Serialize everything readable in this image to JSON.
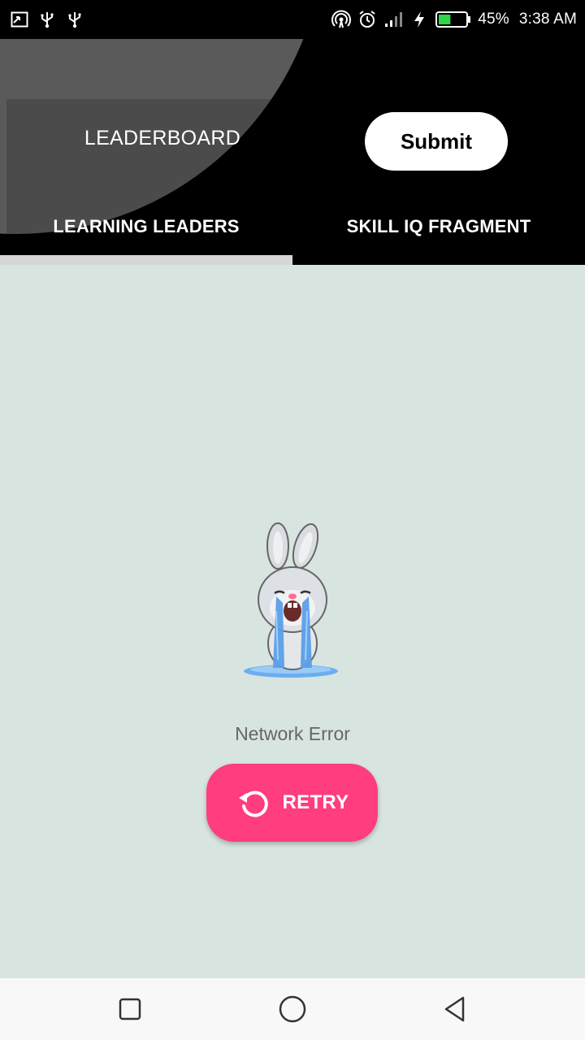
{
  "status_bar": {
    "battery_percent": "45%",
    "time": "3:38 AM",
    "battery_level": 0.45,
    "icons_left": [
      "screenshot-icon",
      "usb-icon",
      "usb-icon"
    ],
    "icons_right": [
      "hotspot-icon",
      "alarm-icon",
      "signal-icon",
      "charging-icon",
      "battery-icon"
    ]
  },
  "header": {
    "title": "LEADERBOARD",
    "submit_label": "Submit",
    "tabs": [
      {
        "label": "LEARNING LEADERS",
        "selected": true
      },
      {
        "label": "SKILL IQ FRAGMENT",
        "selected": false
      }
    ]
  },
  "content": {
    "error_message": "Network Error",
    "illustration": "crying-bunny-icon",
    "retry_label": "RETRY"
  },
  "nav_bar": {
    "buttons": [
      "recents-icon",
      "home-icon",
      "back-icon"
    ]
  },
  "colors": {
    "header_bg": "#000000",
    "content_bg": "#d8e4e0",
    "accent": "#ff3d7f",
    "tab_indicator": "#d6d6d6",
    "error_text": "#666666"
  }
}
